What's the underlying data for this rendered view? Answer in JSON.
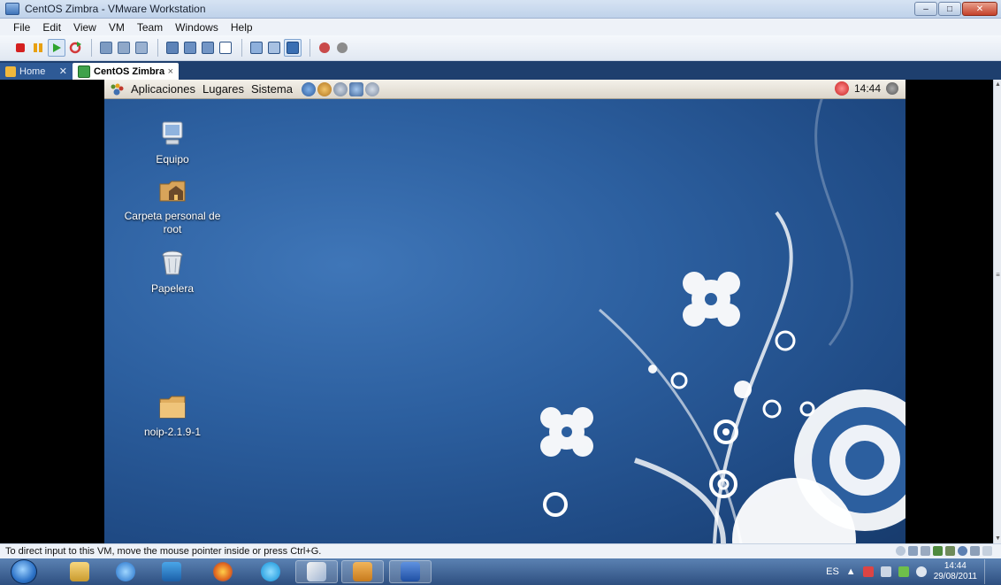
{
  "window": {
    "title": "CentOS Zimbra - VMware Workstation",
    "buttons": {
      "minimize": "–",
      "maximize": "□",
      "close": "✕"
    }
  },
  "menu": {
    "items": [
      "File",
      "Edit",
      "View",
      "VM",
      "Team",
      "Windows",
      "Help"
    ]
  },
  "tabs": {
    "home_label": "Home",
    "home_close": "✕",
    "active_label": "CentOS Zimbra",
    "active_close": "×"
  },
  "guest": {
    "panel": {
      "menus": [
        "Aplicaciones",
        "Lugares",
        "Sistema"
      ],
      "clock": "14:44"
    },
    "icons": [
      {
        "label": "Equipo",
        "icon": "computer-icon"
      },
      {
        "label": "Carpeta personal de root",
        "icon": "home-folder-icon"
      },
      {
        "label": "Papelera",
        "icon": "trash-icon"
      },
      {
        "label": "noip-2.1.9-1",
        "icon": "folder-icon"
      }
    ]
  },
  "status": {
    "message": "To direct input to this VM, move the mouse pointer inside or press Ctrl+G."
  },
  "taskbar": {
    "language": "ES",
    "time": "14:44",
    "date": "29/08/2011"
  },
  "colors": {
    "tab_bar": "#1e3f6e",
    "desktop_blue": "#2c5f9f",
    "taskbar_top": "#5b82b3"
  }
}
